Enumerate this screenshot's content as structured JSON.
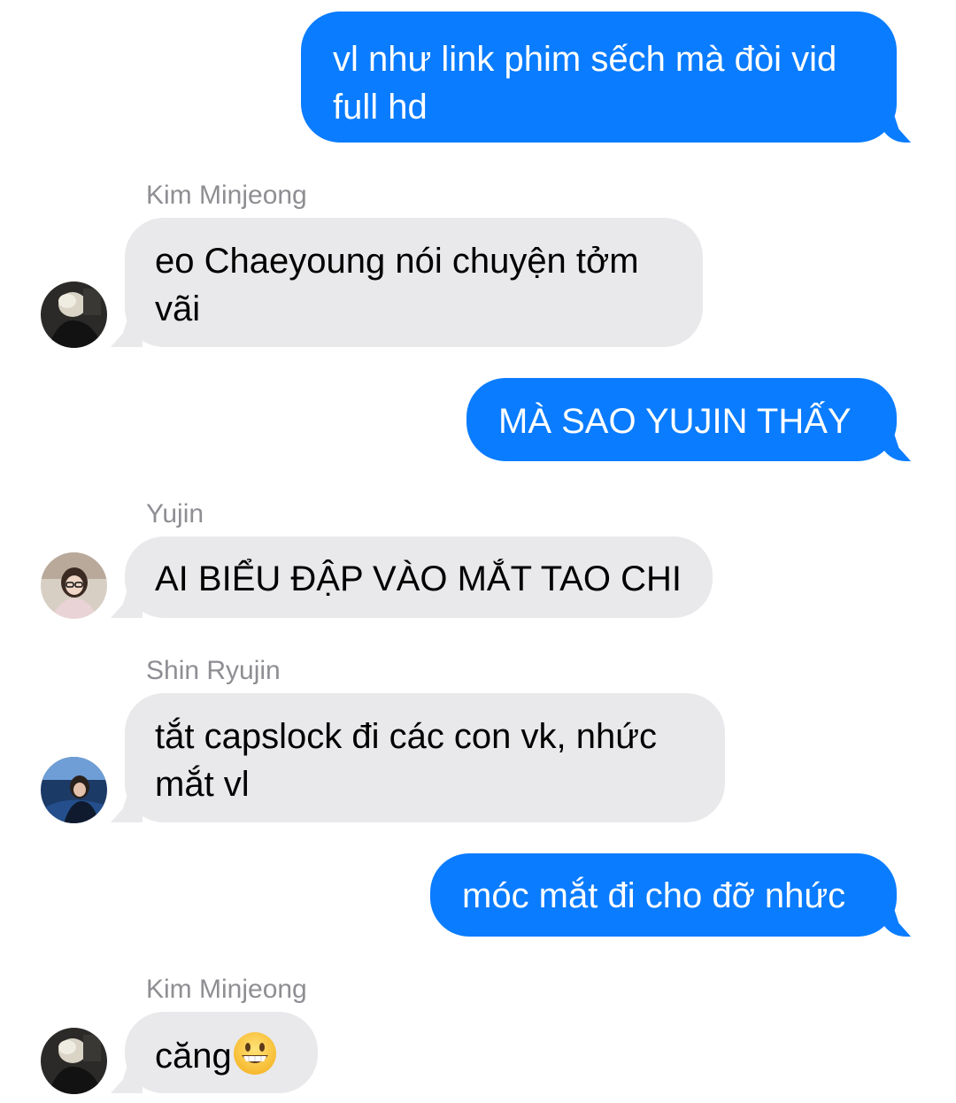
{
  "messages": [
    {
      "type": "outgoing",
      "text_lines": [
        "vl như link phim sếch mà đòi vid",
        "full hd"
      ]
    },
    {
      "type": "incoming",
      "sender": "Kim Minjeong",
      "text_lines": [
        "eo Chaeyoung nói chuyện tởm",
        "vãi"
      ]
    },
    {
      "type": "outgoing",
      "text_lines": [
        "MÀ SAO YUJIN THẤY"
      ]
    },
    {
      "type": "incoming",
      "sender": "Yujin",
      "text_lines": [
        "AI BIỂU ĐẬP VÀO MẮT TAO CHI"
      ]
    },
    {
      "type": "incoming",
      "sender": "Shin Ryujin",
      "text_lines": [
        "tắt capslock đi các con vk, nhức",
        "mắt vl"
      ]
    },
    {
      "type": "outgoing",
      "text_lines": [
        "móc mắt đi cho đỡ nhức"
      ]
    },
    {
      "type": "incoming",
      "sender": "Kim Minjeong",
      "text_lines": [
        "căng"
      ],
      "emoji": "grinning-face-emoji"
    }
  ],
  "colors": {
    "outgoing_bubble": "#0a7cff",
    "incoming_bubble": "#e9e9eb",
    "sender_name": "#8e8e93"
  }
}
